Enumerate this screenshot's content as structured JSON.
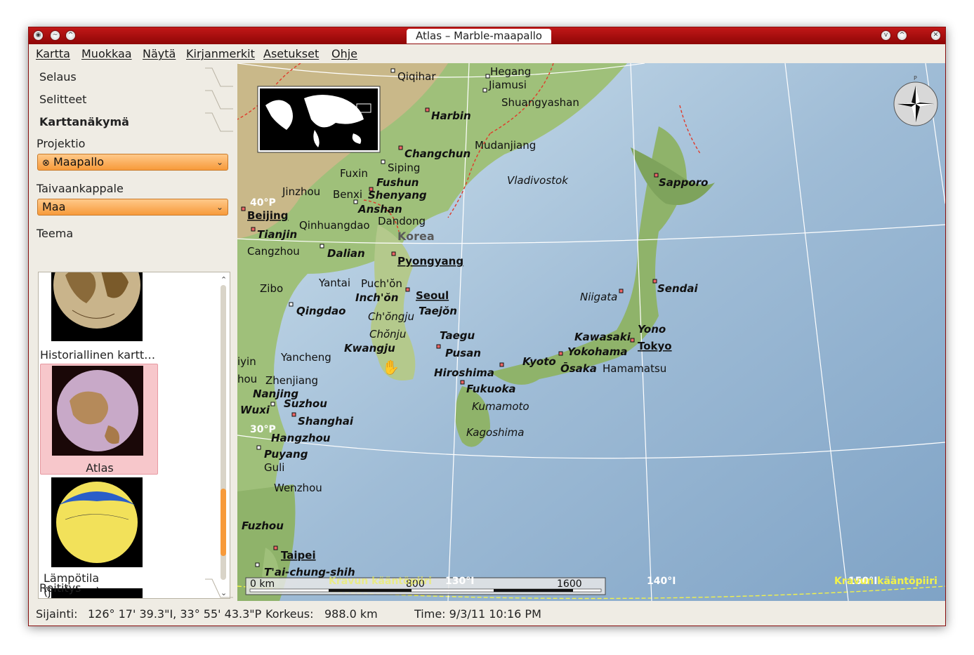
{
  "window": {
    "title": "Atlas – Marble-maapallo"
  },
  "menu": [
    "Kartta",
    "Muokkaa",
    "Näytä",
    "Kirjanmerkit",
    "Asetukset",
    "Ohje"
  ],
  "sidebar": {
    "tabs": [
      "Selaus",
      "Selitteet",
      "Karttanäkymä",
      "Reititys"
    ],
    "projection_label": "Projektio",
    "projection_value": "Maapallo",
    "celestial_label": "Taivaankappale",
    "celestial_value": "Maa",
    "theme_label": "Teema",
    "themes": [
      "Historiallinen kartt…",
      "Atlas",
      "Lämpötila (joulukuu)"
    ]
  },
  "map": {
    "labels": {
      "qiqihar": "Qiqihar",
      "hegang": "Hegang",
      "jiamusi": "Jiamusi",
      "shuangyashan": "Shuangyashan",
      "harbin": "Harbin",
      "changchun": "Changchun",
      "mudanjiang": "Mudanjiang",
      "siping": "Siping",
      "fuxin": "Fuxin",
      "fushun": "Fushun",
      "vladivostok": "Vladivostok",
      "jinzhou": "Jinzhou",
      "benxi": "Benxi",
      "shenyang": "Shenyang",
      "anshan": "Anshan",
      "sapporo": "Sapporo",
      "beijing": "Beijing",
      "qinhuangdao": "Qinhuangdao",
      "dandong": "Dandong",
      "tianjin": "Tianjin",
      "korea": "Korea",
      "cangzhou": "Cangzhou",
      "dalian": "Dalian",
      "pyongyang": "Pyongyang",
      "yantai": "Yantai",
      "puchon": "Puch'ŏn",
      "zibo": "Zibo",
      "seoul": "Seoul",
      "sendai": "Sendai",
      "inchon": "Inch'ŏn",
      "niigata": "Niigata",
      "qingdao": "Qingdao",
      "taejon": "Taejŏn",
      "chongju": "Ch'ŏngju",
      "chonju": "Chŏnju",
      "taegu": "Taegu",
      "yono": "Yono",
      "kawasaki": "Kawasaki",
      "kwangju": "Kwangju",
      "pusan": "Pusan",
      "tokyo": "Tokyo",
      "yokohama": "Yokohama",
      "yancheng": "Yancheng",
      "hiroshima": "Hiroshima",
      "kyoto": "Kyoto",
      "osaka": "Ōsaka",
      "hamamatsu": "Hamamatsu",
      "zhenjiang": "Zhenjiang",
      "fukuoka": "Fukuoka",
      "nanjing": "Nanjing",
      "suzhou": "Suzhou",
      "kumamoto": "Kumamoto",
      "wuxi": "Wuxi",
      "shanghai": "Shanghai",
      "kagoshima": "Kagoshima",
      "hangzhou": "Hangzhou",
      "puyang": "Puyang",
      "guli": "Guli",
      "wenzhou": "Wenzhou",
      "fuzhou": "Fuzhou",
      "taipei": "Taipei",
      "taichung": "T'ai-chung-shih",
      "yiyin": "iyin",
      "hou": "hou"
    },
    "grid": {
      "lat40": "40°P",
      "lat30": "30°P",
      "lon130": "130°I",
      "lon140": "140°I",
      "lon150": "150°I"
    },
    "tropic": "Kravun kääntöpiiri",
    "scale": {
      "zero": "0 km",
      "mid": "800",
      "max": "1600"
    },
    "compass_n": "P"
  },
  "status": {
    "position_label": "Sijainti:",
    "position_value": "126° 17' 39.3\"I,  33° 55' 43.3\"P",
    "altitude_label": "Korkeus:",
    "altitude_value": "988.0 km",
    "time": "Time: 9/3/11 10:16 PM"
  },
  "colors": {
    "titlebar": "#b31010",
    "accent": "#f79a3a",
    "selected": "#f7c7cb",
    "sea": "#a8c4dc",
    "land": "#8fb36a"
  }
}
